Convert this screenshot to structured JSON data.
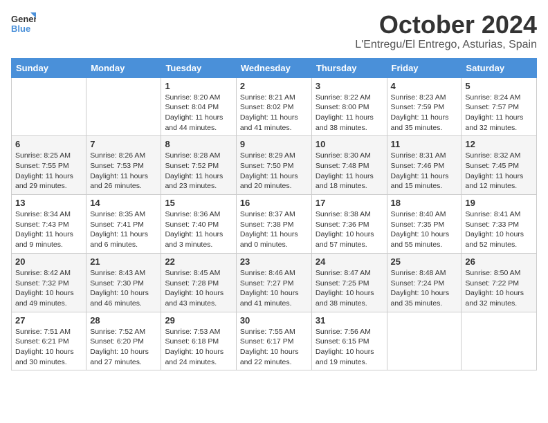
{
  "logo": {
    "line1": "General",
    "line2": "Blue"
  },
  "title": "October 2024",
  "location": "L'Entregu/El Entrego, Asturias, Spain",
  "weekdays": [
    "Sunday",
    "Monday",
    "Tuesday",
    "Wednesday",
    "Thursday",
    "Friday",
    "Saturday"
  ],
  "weeks": [
    [
      {
        "day": "",
        "text": ""
      },
      {
        "day": "",
        "text": ""
      },
      {
        "day": "1",
        "text": "Sunrise: 8:20 AM\nSunset: 8:04 PM\nDaylight: 11 hours and 44 minutes."
      },
      {
        "day": "2",
        "text": "Sunrise: 8:21 AM\nSunset: 8:02 PM\nDaylight: 11 hours and 41 minutes."
      },
      {
        "day": "3",
        "text": "Sunrise: 8:22 AM\nSunset: 8:00 PM\nDaylight: 11 hours and 38 minutes."
      },
      {
        "day": "4",
        "text": "Sunrise: 8:23 AM\nSunset: 7:59 PM\nDaylight: 11 hours and 35 minutes."
      },
      {
        "day": "5",
        "text": "Sunrise: 8:24 AM\nSunset: 7:57 PM\nDaylight: 11 hours and 32 minutes."
      }
    ],
    [
      {
        "day": "6",
        "text": "Sunrise: 8:25 AM\nSunset: 7:55 PM\nDaylight: 11 hours and 29 minutes."
      },
      {
        "day": "7",
        "text": "Sunrise: 8:26 AM\nSunset: 7:53 PM\nDaylight: 11 hours and 26 minutes."
      },
      {
        "day": "8",
        "text": "Sunrise: 8:28 AM\nSunset: 7:52 PM\nDaylight: 11 hours and 23 minutes."
      },
      {
        "day": "9",
        "text": "Sunrise: 8:29 AM\nSunset: 7:50 PM\nDaylight: 11 hours and 20 minutes."
      },
      {
        "day": "10",
        "text": "Sunrise: 8:30 AM\nSunset: 7:48 PM\nDaylight: 11 hours and 18 minutes."
      },
      {
        "day": "11",
        "text": "Sunrise: 8:31 AM\nSunset: 7:46 PM\nDaylight: 11 hours and 15 minutes."
      },
      {
        "day": "12",
        "text": "Sunrise: 8:32 AM\nSunset: 7:45 PM\nDaylight: 11 hours and 12 minutes."
      }
    ],
    [
      {
        "day": "13",
        "text": "Sunrise: 8:34 AM\nSunset: 7:43 PM\nDaylight: 11 hours and 9 minutes."
      },
      {
        "day": "14",
        "text": "Sunrise: 8:35 AM\nSunset: 7:41 PM\nDaylight: 11 hours and 6 minutes."
      },
      {
        "day": "15",
        "text": "Sunrise: 8:36 AM\nSunset: 7:40 PM\nDaylight: 11 hours and 3 minutes."
      },
      {
        "day": "16",
        "text": "Sunrise: 8:37 AM\nSunset: 7:38 PM\nDaylight: 11 hours and 0 minutes."
      },
      {
        "day": "17",
        "text": "Sunrise: 8:38 AM\nSunset: 7:36 PM\nDaylight: 10 hours and 57 minutes."
      },
      {
        "day": "18",
        "text": "Sunrise: 8:40 AM\nSunset: 7:35 PM\nDaylight: 10 hours and 55 minutes."
      },
      {
        "day": "19",
        "text": "Sunrise: 8:41 AM\nSunset: 7:33 PM\nDaylight: 10 hours and 52 minutes."
      }
    ],
    [
      {
        "day": "20",
        "text": "Sunrise: 8:42 AM\nSunset: 7:32 PM\nDaylight: 10 hours and 49 minutes."
      },
      {
        "day": "21",
        "text": "Sunrise: 8:43 AM\nSunset: 7:30 PM\nDaylight: 10 hours and 46 minutes."
      },
      {
        "day": "22",
        "text": "Sunrise: 8:45 AM\nSunset: 7:28 PM\nDaylight: 10 hours and 43 minutes."
      },
      {
        "day": "23",
        "text": "Sunrise: 8:46 AM\nSunset: 7:27 PM\nDaylight: 10 hours and 41 minutes."
      },
      {
        "day": "24",
        "text": "Sunrise: 8:47 AM\nSunset: 7:25 PM\nDaylight: 10 hours and 38 minutes."
      },
      {
        "day": "25",
        "text": "Sunrise: 8:48 AM\nSunset: 7:24 PM\nDaylight: 10 hours and 35 minutes."
      },
      {
        "day": "26",
        "text": "Sunrise: 8:50 AM\nSunset: 7:22 PM\nDaylight: 10 hours and 32 minutes."
      }
    ],
    [
      {
        "day": "27",
        "text": "Sunrise: 7:51 AM\nSunset: 6:21 PM\nDaylight: 10 hours and 30 minutes."
      },
      {
        "day": "28",
        "text": "Sunrise: 7:52 AM\nSunset: 6:20 PM\nDaylight: 10 hours and 27 minutes."
      },
      {
        "day": "29",
        "text": "Sunrise: 7:53 AM\nSunset: 6:18 PM\nDaylight: 10 hours and 24 minutes."
      },
      {
        "day": "30",
        "text": "Sunrise: 7:55 AM\nSunset: 6:17 PM\nDaylight: 10 hours and 22 minutes."
      },
      {
        "day": "31",
        "text": "Sunrise: 7:56 AM\nSunset: 6:15 PM\nDaylight: 10 hours and 19 minutes."
      },
      {
        "day": "",
        "text": ""
      },
      {
        "day": "",
        "text": ""
      }
    ]
  ]
}
